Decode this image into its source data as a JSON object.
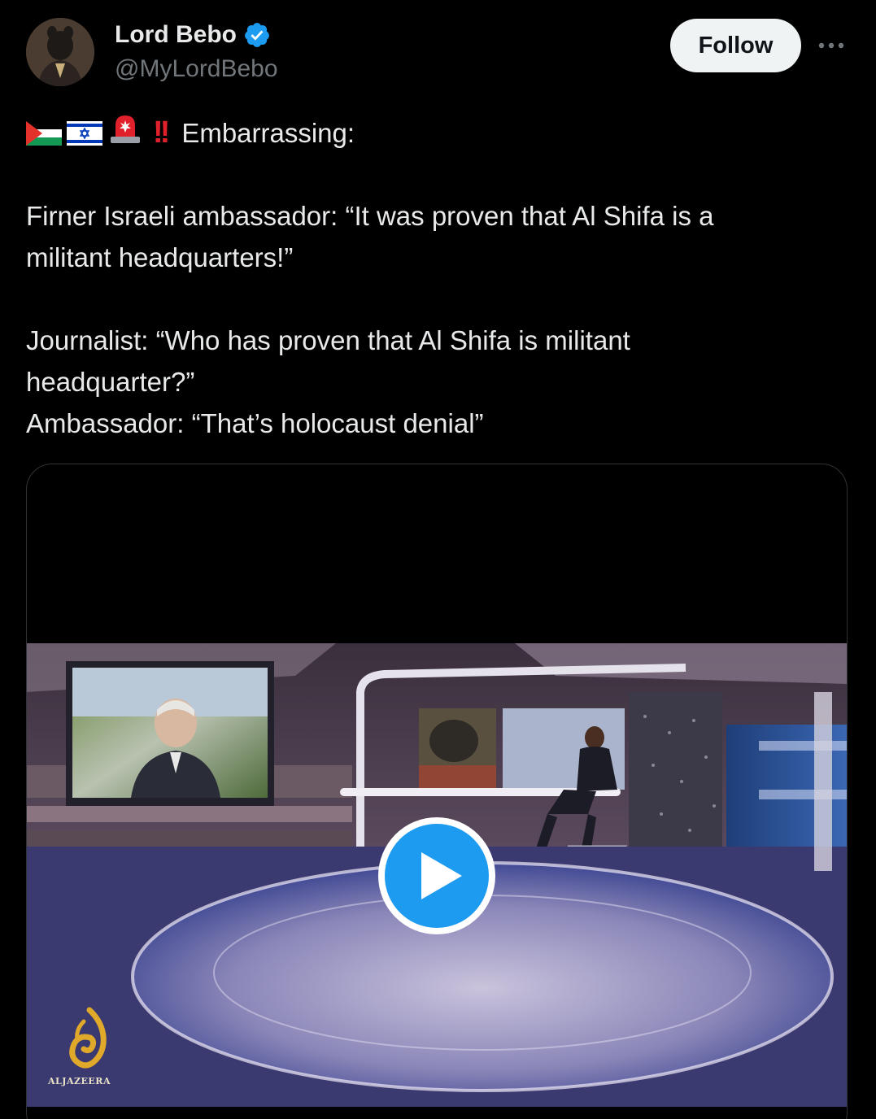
{
  "author": {
    "name": "Lord Bebo",
    "handle": "@MyLordBebo",
    "verified": true,
    "avatar_icon": "avatar-icon"
  },
  "actions": {
    "follow_label": "Follow",
    "more_icon": "more-icon"
  },
  "post": {
    "emoji_prefix": [
      "palestine-flag-icon",
      "israel-flag-icon",
      "siren-icon",
      "double-exclamation-icon"
    ],
    "lines": [
      "Embarrassing:",
      "",
      "Firner Israeli ambassador: “It was proven that Al Shifa is a",
      "militant headquarters!”",
      "",
      "Journalist:  “Who has proven that Al Shifa is militant",
      "headquarter?”",
      "Ambassador: “That’s holocaust denial”"
    ]
  },
  "media": {
    "type": "video",
    "play_icon": "play-icon",
    "watermark": "ALJAZEERA",
    "accent_color": "#1d9bf0"
  }
}
